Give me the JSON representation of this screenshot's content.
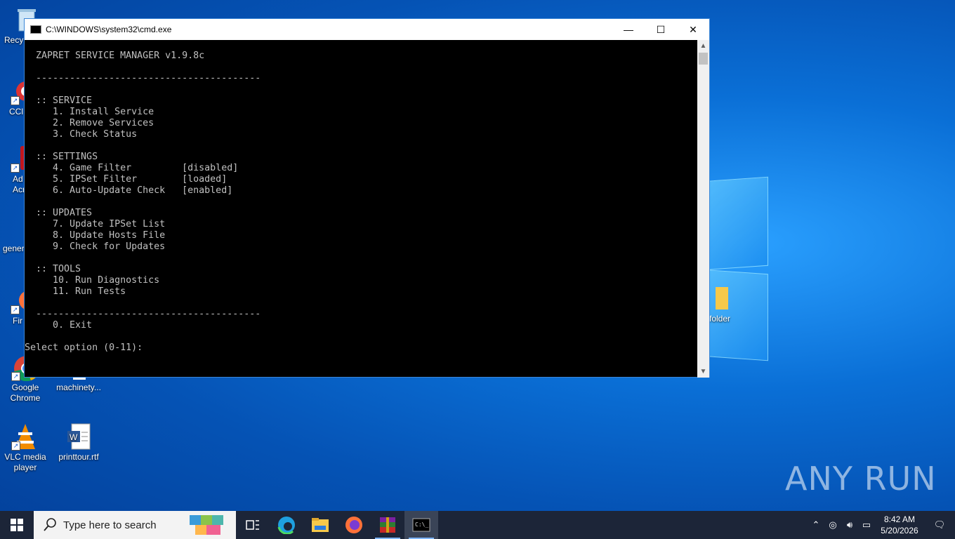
{
  "desktop": {
    "icons": [
      {
        "label": "Recy",
        "icon": "recycle-bin-icon"
      },
      {
        "label": "CCl",
        "icon": "ccleaner-icon"
      },
      {
        "label": "Ad\nAcr",
        "icon": "adobe-acrobat-icon"
      },
      {
        "label": "gener",
        "icon": "document-icon"
      },
      {
        "label": "Fir",
        "icon": "firefox-icon"
      },
      {
        "label": "Google\nChrome",
        "icon": "chrome-icon"
      },
      {
        "label": "machinety...",
        "icon": "blank-document-icon"
      },
      {
        "label": "VLC media\nplayer",
        "icon": "vlc-icon"
      },
      {
        "label": "printtour.rtf",
        "icon": "word-document-icon"
      },
      {
        "label": "folder",
        "icon": "folder-icon"
      }
    ],
    "watermark": "ANY RUN"
  },
  "cmd": {
    "title": "C:\\WINDOWS\\system32\\cmd.exe",
    "minimize": "—",
    "maximize": "☐",
    "close": "✕",
    "output": "  ZAPRET SERVICE MANAGER v1.9.8c\n\n  ----------------------------------------\n\n  :: SERVICE\n     1. Install Service\n     2. Remove Services\n     3. Check Status\n\n  :: SETTINGS\n     4. Game Filter         [disabled]\n     5. IPSet Filter        [loaded]\n     6. Auto-Update Check   [enabled]\n\n  :: UPDATES\n     7. Update IPSet List\n     8. Update Hosts File\n     9. Check for Updates\n\n  :: TOOLS\n     10. Run Diagnostics\n     11. Run Tests\n\n  ----------------------------------------\n     0. Exit\n\nSelect option (0-11): "
  },
  "taskbar": {
    "search_placeholder": "Type here to search",
    "apps": [
      "task-view-icon",
      "edge-icon",
      "file-explorer-icon",
      "firefox-icon",
      "winrar-icon",
      "cmd-icon"
    ],
    "clock_time": "8:42 AM",
    "clock_date": "5/20/2026"
  }
}
